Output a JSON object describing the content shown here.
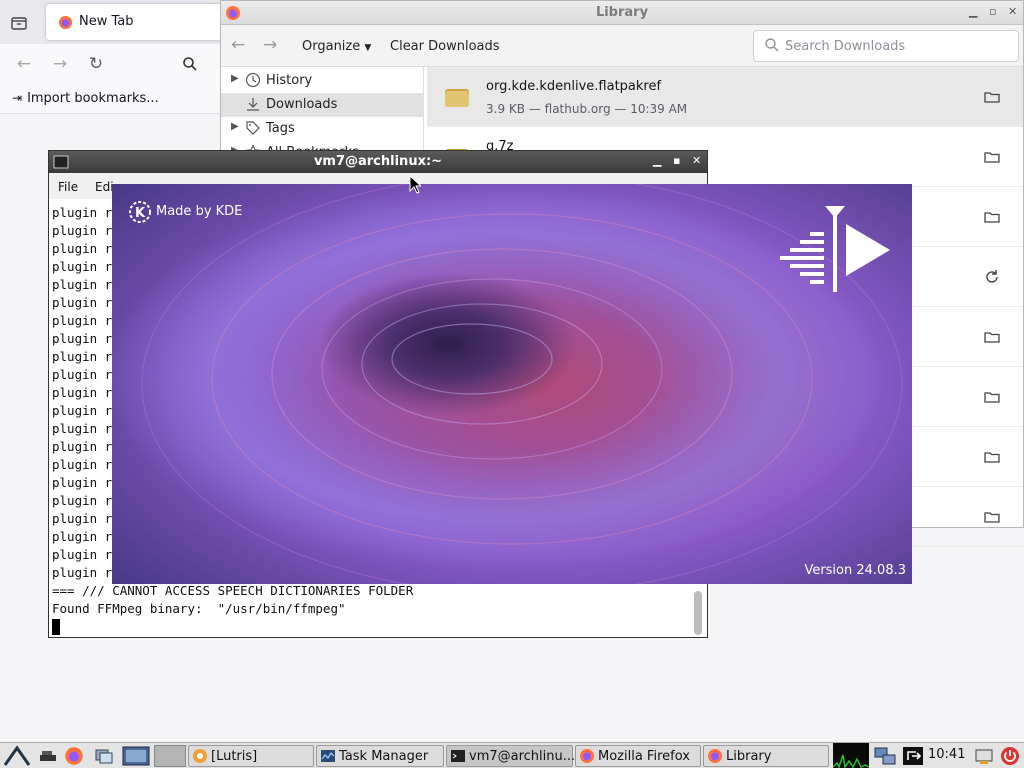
{
  "firefox": {
    "tab_title": "New Tab",
    "bookmarks_import": "Import bookmarks..."
  },
  "library": {
    "window_title": "Library",
    "organize_label": "Organize",
    "clear_downloads_label": "Clear Downloads",
    "search_placeholder": "Search Downloads",
    "sidebar": [
      {
        "label": "History",
        "icon": "clock-icon",
        "expandable": true
      },
      {
        "label": "Downloads",
        "icon": "download-icon",
        "expandable": false,
        "selected": true
      },
      {
        "label": "Tags",
        "icon": "tag-icon",
        "expandable": true
      },
      {
        "label": "All Bookmarks",
        "icon": "star-icon",
        "expandable": true
      }
    ],
    "downloads": [
      {
        "name": "org.kde.kdenlive.flatpakref",
        "status": "3.9 KB — flathub.org — 10:39 AM",
        "action": "folder-icon",
        "selected": true
      },
      {
        "name": "g.7z",
        "status": "",
        "action": "folder-icon"
      },
      {
        "name": "",
        "status": "",
        "action": "folder-icon"
      },
      {
        "name": "",
        "status": "",
        "action": "retry-icon"
      },
      {
        "name": "",
        "status": "",
        "action": "folder-icon"
      },
      {
        "name": "",
        "status": "",
        "action": "folder-icon"
      },
      {
        "name": "",
        "status": "",
        "action": "folder-icon"
      },
      {
        "name": "",
        "status": "",
        "action": "folder-icon"
      }
    ]
  },
  "terminal": {
    "window_title": "vm7@archlinux:~",
    "menu": [
      "File",
      "Edi"
    ],
    "lines": [
      "plugin r",
      "plugin r",
      "plugin r",
      "plugin r",
      "plugin r",
      "plugin r",
      "plugin r",
      "plugin r",
      "plugin r",
      "plugin r",
      "plugin r",
      "plugin r",
      "plugin r",
      "plugin r",
      "plugin r",
      "plugin r",
      "plugin r",
      "plugin r",
      "plugin r",
      "plugin r",
      "plugin r"
    ],
    "speech_line": "=== /// CANNOT ACCESS SPEECH DICTIONARIES FOLDER",
    "ffmpeg_line": "Found FFMpeg binary:  \"/usr/bin/ffmpeg\""
  },
  "splash": {
    "made_by": "Made by KDE",
    "version": "Version 24.08.3"
  },
  "taskbar": {
    "tasks": [
      {
        "label": "[Lutris]",
        "icon": "lutris-icon"
      },
      {
        "label": "Task Manager",
        "icon": "task-manager-icon"
      },
      {
        "label": "vm7@archlinu...",
        "icon": "terminal-icon"
      },
      {
        "label": "Mozilla Firefox",
        "icon": "firefox-icon"
      },
      {
        "label": "Library",
        "icon": "firefox-icon"
      }
    ],
    "clock": "10:41"
  }
}
